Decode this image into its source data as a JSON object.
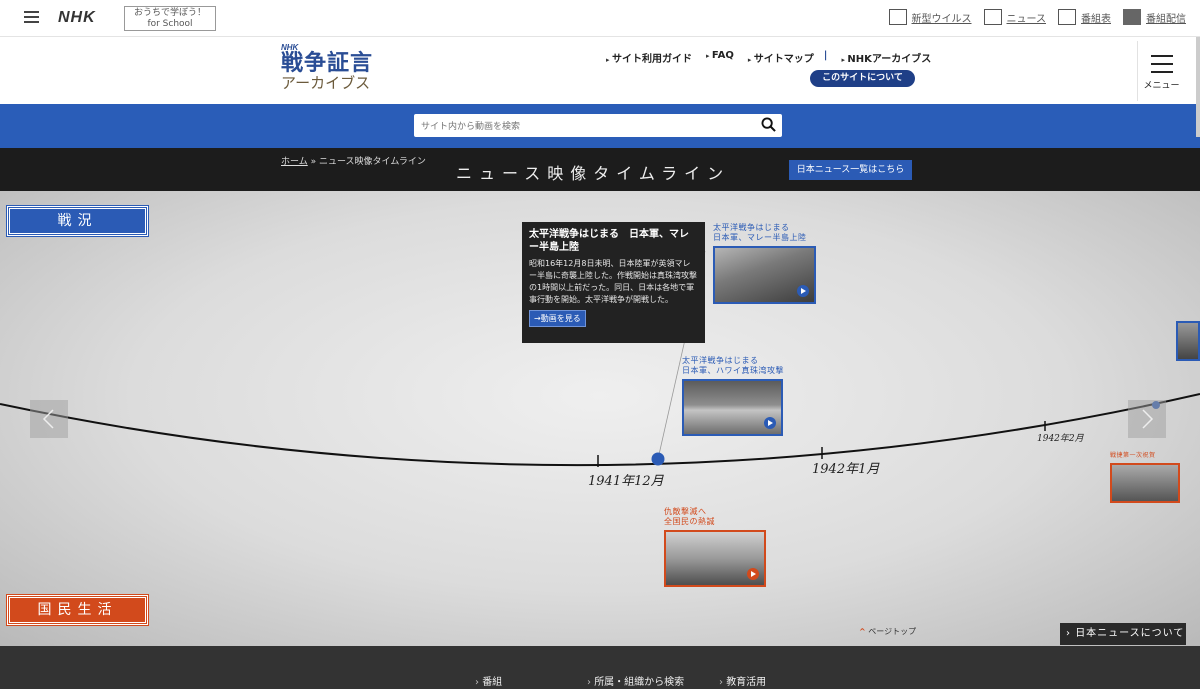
{
  "nhkbar": {
    "logo": "NHK",
    "school_line1": "おうちで学ぼう！",
    "school_line2": "for School",
    "links": [
      "新型ウイルス",
      "ニュース",
      "番組表",
      "番組配信"
    ]
  },
  "header": {
    "brand_small": "NHK",
    "brand_title": "戦争証言",
    "brand_sub": "アーカイブス",
    "nav": [
      "サイト利用ガイド",
      "FAQ",
      "サイトマップ",
      "NHKアーカイブス"
    ],
    "about_button": "このサイトについて",
    "menu_label": "メニュー"
  },
  "search": {
    "placeholder": "サイト内から動画を検索"
  },
  "titlebar": {
    "breadcrumb_home": "ホーム",
    "breadcrumb_sep": " » ",
    "breadcrumb_current": "ニュース映像タイムライン",
    "title": "ニュース映像タイムライン",
    "list_button": "日本ニュース一覧はこちら"
  },
  "timeline": {
    "category_war": "戦況",
    "category_life": "国民生活",
    "popup": {
      "heading": "太平洋戦争はじまる　日本軍、マレー半島上陸",
      "body": "昭和16年12月8日未明、日本陸軍が英領マレー半島に奇襲上陸した。作戦開始は真珠湾攻撃の1時間以上前だった。同日、日本は各地で軍事行動を開始。太平洋戦争が開戦した。",
      "button": "→動画を見る"
    },
    "cards": [
      {
        "label1": "太平洋戦争はじまる",
        "label2": "日本軍、マレー半島上陸"
      },
      {
        "label1": "太平洋戦争はじまる",
        "label2": "日本軍、ハワイ真珠湾攻撃"
      },
      {
        "label1": "仇敵撃滅へ",
        "label2": "全国民の熱誠"
      },
      {
        "label1": "戦捷第一次祝賀"
      }
    ],
    "ticks": [
      "1941年12月",
      "1942年1月",
      "1942年2月"
    ],
    "page_top": "ページトップ",
    "about_news": "日本ニュースについて"
  },
  "footer": {
    "links": [
      "番組",
      "所属・組織から検索",
      "教育活用"
    ]
  },
  "colors": {
    "blue": "#2b5bb5",
    "navy": "#1f3f87",
    "red": "#d24a1c",
    "dark": "#1c1c1c"
  }
}
